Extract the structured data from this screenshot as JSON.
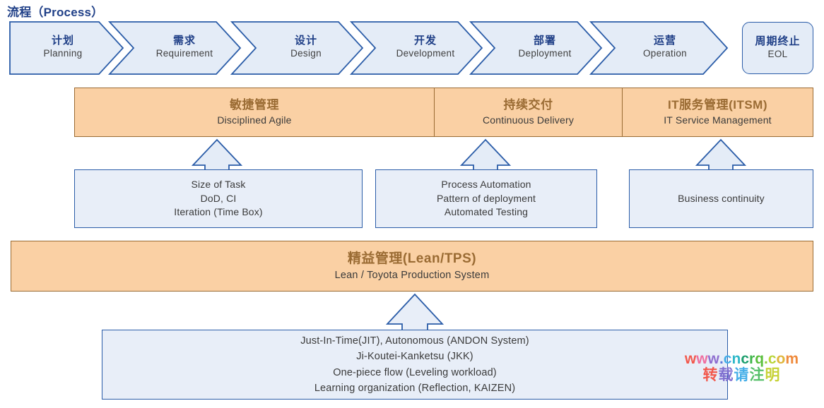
{
  "title": "流程（Process）",
  "colors": {
    "title_blue": "#1f3f87",
    "chev_fill": "#e4ecf7",
    "chev_border": "#2a5ca8",
    "orange_fill": "#fad0a4",
    "orange_border": "#9a6b33",
    "orange_text": "#9a6b33",
    "box_fill": "#e8eef8",
    "box_border": "#2a5ca8",
    "body_text": "#3a3a3a"
  },
  "process": {
    "stages": [
      {
        "cn": "计划",
        "en": "Planning"
      },
      {
        "cn": "需求",
        "en": "Requirement"
      },
      {
        "cn": "设计",
        "en": "Design"
      },
      {
        "cn": "开发",
        "en": "Development"
      },
      {
        "cn": "部署",
        "en": "Deployment"
      },
      {
        "cn": "运营",
        "en": "Operation"
      }
    ],
    "end": {
      "cn": "周期终止",
      "en": "EOL"
    }
  },
  "practice_band": {
    "segments": [
      {
        "cn": "敏捷管理",
        "en": "Disciplined Agile"
      },
      {
        "cn": "持续交付",
        "en": "Continuous Delivery"
      },
      {
        "cn": "IT服务管理(ITSM)",
        "en": "IT Service Management"
      }
    ]
  },
  "detail_boxes": [
    {
      "lines": [
        "Size of Task",
        "DoD, CI",
        "Iteration (Time Box)"
      ]
    },
    {
      "lines": [
        "Process Automation",
        "Pattern of deployment",
        "Automated Testing"
      ]
    },
    {
      "lines": [
        "Business continuity"
      ]
    }
  ],
  "lean_band": {
    "cn": "精益管理(Lean/TPS)",
    "en": "Lean / Toyota Production System"
  },
  "lean_detail": {
    "lines": [
      "Just-In-Time(JIT), Autonomous (ANDON System)",
      "Ji-Koutei-Kanketsu (JKK)",
      "One-piece flow (Leveling workload)",
      "Learning organization (Reflection, KAIZEN)"
    ]
  },
  "watermark": {
    "line1": "www.cncrq.com",
    "line2": "转载请注明",
    "line1_colors": [
      "#f2584c",
      "#ef6fa0",
      "#8f6fd0",
      "#5a78d8",
      "#46aee8",
      "#2fb8c8",
      "#1f9f6e",
      "#3fb54a",
      "#5bbf3e",
      "#8fce3a",
      "#b9d53a",
      "#e0b63c",
      "#ef8a3c"
    ],
    "line2_colors": [
      "#f2584c",
      "#7f6fd0",
      "#46aee8",
      "#57c06a",
      "#c7d238"
    ]
  }
}
